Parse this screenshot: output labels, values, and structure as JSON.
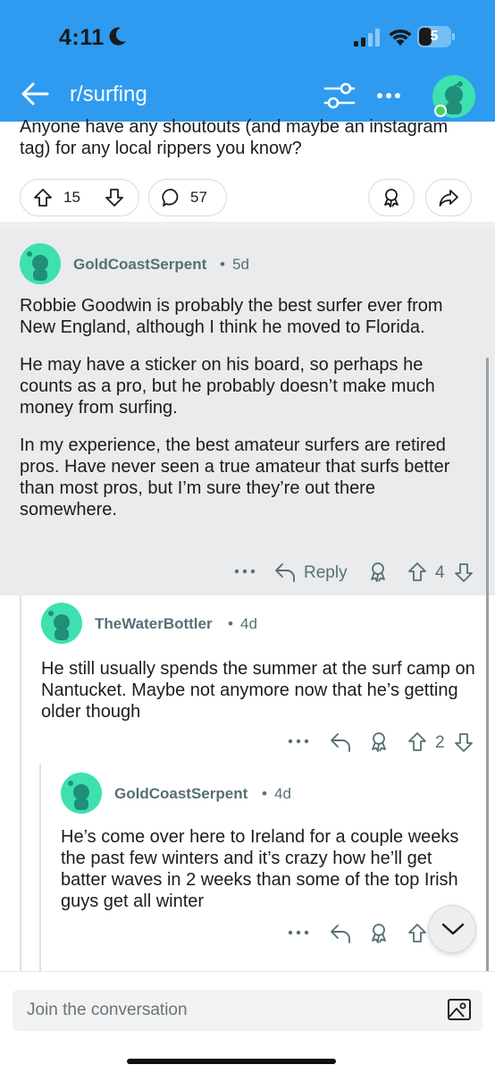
{
  "status": {
    "time": "4:11",
    "battery": "5"
  },
  "nav": {
    "subreddit": "r/surfing"
  },
  "post": {
    "text": "Anyone have any shoutouts (and maybe an instagram tag) for any local rippers you know?",
    "upvotes": "15",
    "comments": "57"
  },
  "comments": [
    {
      "user": "GoldCoastSerpent",
      "dot": "•",
      "age": "5d",
      "paragraphs": [
        "Robbie Goodwin is probably the best surfer ever from New England, although I think he moved to Florida.",
        "He may have a sticker on his board, so perhaps he counts as a pro, but he probably doesn’t make much money from surfing.",
        "In my experience, the best amateur surfers are retired pros. Have never seen a true amateur that surfs better than most pros, but I’m sure they’re out there somewhere."
      ],
      "reply_label": "Reply",
      "score": "4"
    },
    {
      "user": "TheWaterBottler",
      "dot": "•",
      "age": "4d",
      "text": "He still usually spends the summer at the surf camp on Nantucket. Maybe not anymore now that he’s getting older though",
      "score": "2"
    },
    {
      "user": "GoldCoastSerpent",
      "dot": "•",
      "age": "4d",
      "text": "He’s come over here to Ireland for a couple weeks the past few winters and it’s crazy how he’ll get batter waves in 2 weeks than some of the top Irish guys get all winter"
    }
  ],
  "compose": {
    "placeholder": "Join the conversation"
  },
  "icons": {
    "back": "arrow-left-icon",
    "filter": "filter-icon",
    "more": "more-dots-icon",
    "upvote": "upvote-arrow-icon",
    "downvote": "downvote-arrow-icon",
    "comment": "comment-bubble-icon",
    "award": "award-icon",
    "share": "share-icon",
    "reply": "reply-arrow-icon",
    "image": "image-icon",
    "chevron": "chevron-down-icon"
  },
  "colors": {
    "header": "#2e9bf0",
    "avatar": "#3ee0b0",
    "highlight": "#e9ebed"
  }
}
